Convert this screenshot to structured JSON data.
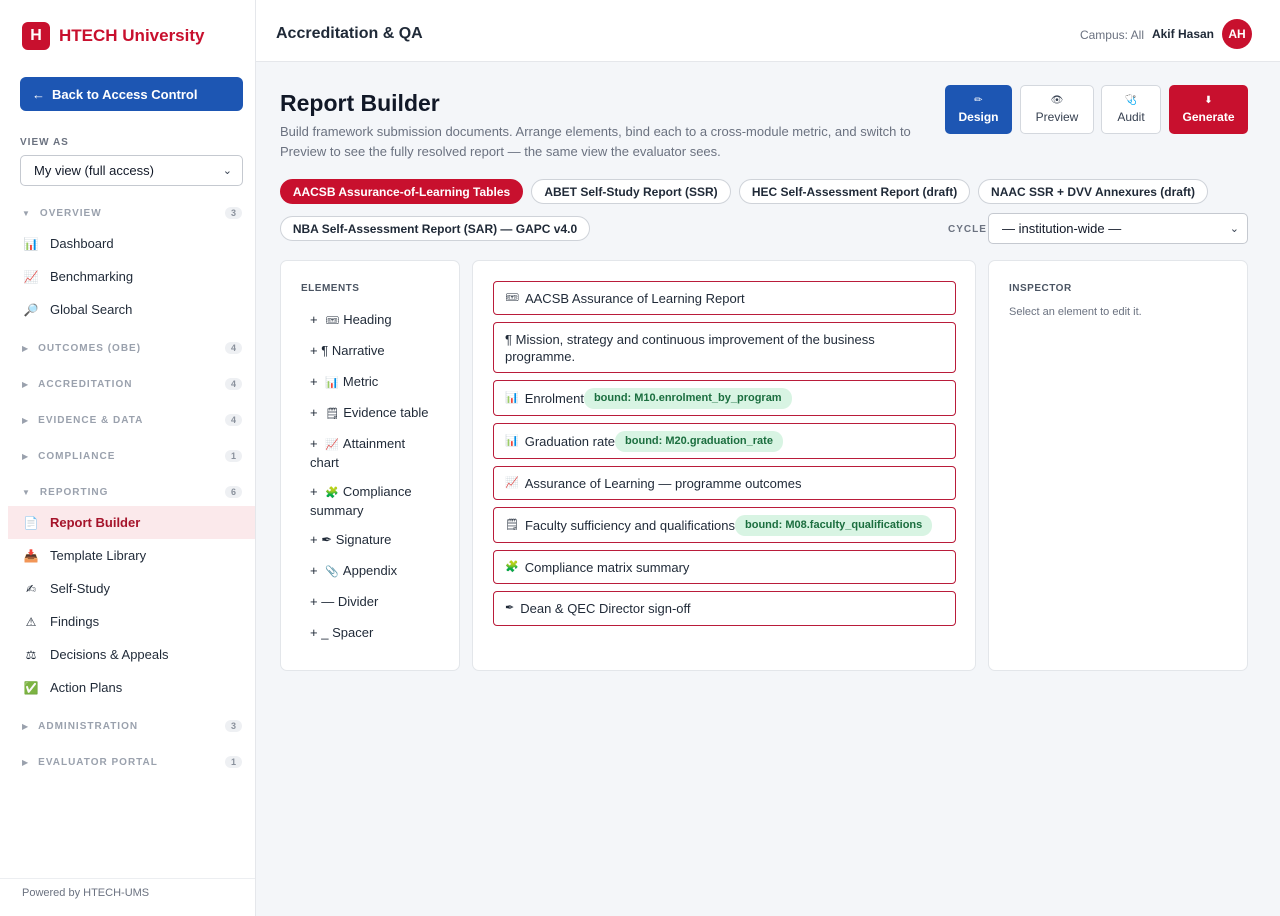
{
  "brand": {
    "logo": "H",
    "name": "HTECH University"
  },
  "sidebar": {
    "back_label": "Back to Access Control",
    "view_as_label": "VIEW AS",
    "view_as_value": "My view (full access)",
    "sections": [
      {
        "label": "OVERVIEW",
        "count": "3",
        "expanded": true
      },
      {
        "label": "OUTCOMES (OBE)",
        "count": "4",
        "expanded": false
      },
      {
        "label": "ACCREDITATION",
        "count": "4",
        "expanded": false
      },
      {
        "label": "EVIDENCE & DATA",
        "count": "4",
        "expanded": false
      },
      {
        "label": "COMPLIANCE",
        "count": "1",
        "expanded": false
      },
      {
        "label": "REPORTING",
        "count": "6",
        "expanded": true
      },
      {
        "label": "ADMINISTRATION",
        "count": "3",
        "expanded": false
      },
      {
        "label": "EVALUATOR PORTAL",
        "count": "1",
        "expanded": false
      }
    ],
    "overview_items": [
      {
        "label": "Dashboard",
        "icon": "📊"
      },
      {
        "label": "Benchmarking",
        "icon": "📈"
      },
      {
        "label": "Global Search",
        "icon": "🔎"
      }
    ],
    "reporting_items": [
      {
        "label": "Report Builder",
        "icon": "📄"
      },
      {
        "label": "Template Library",
        "icon": "📥"
      },
      {
        "label": "Self-Study",
        "icon": "✍"
      },
      {
        "label": "Findings",
        "icon": "⚠"
      },
      {
        "label": "Decisions & Appeals",
        "icon": "⚖"
      },
      {
        "label": "Action Plans",
        "icon": "✅"
      }
    ],
    "powered_by": "Powered by HTECH-UMS"
  },
  "header": {
    "title": "Accreditation & QA",
    "campus": "Campus: All",
    "user_name": "Akif Hasan",
    "avatar_initials": "AH"
  },
  "main": {
    "title": "Report Builder",
    "description": "Build framework submission documents. Arrange elements, bind each to a cross-module metric, and switch to Preview to see the fully resolved report — the same view the evaluator sees.",
    "modes": [
      {
        "label": "Design",
        "icon": "✏",
        "active": true
      },
      {
        "label": "Preview",
        "icon": "👁"
      },
      {
        "label": "Audit",
        "icon": "🩺"
      },
      {
        "label": "Generate",
        "icon": "⬇"
      }
    ],
    "frameworks": [
      "AACSB Assurance-of-Learning Tables",
      "ABET Self-Study Report (SSR)",
      "HEC Self-Assessment Report (draft)",
      "NAAC SSR + DVV Annexures (draft)",
      "NBA Self-Assessment Report (SAR) — GAPC v4.0"
    ],
    "active_framework_index": 0,
    "cycle_label": "CYCLE",
    "cycle_value": "— institution-wide —",
    "elements_label": "ELEMENTS",
    "elements": [
      {
        "label": "Heading",
        "icon": "🎟"
      },
      {
        "label": "Narrative",
        "icon": "¶"
      },
      {
        "label": "Metric",
        "icon": "📊"
      },
      {
        "label": "Evidence table",
        "icon": "🗒"
      },
      {
        "label": "Attainment chart",
        "icon": "📈"
      },
      {
        "label": "Compliance summary",
        "icon": "🧩"
      },
      {
        "label": "Signature",
        "icon": "✒"
      },
      {
        "label": "Appendix",
        "icon": "📎"
      },
      {
        "label": "Divider",
        "icon": "—"
      },
      {
        "label": "Spacer",
        "icon": "_"
      }
    ],
    "canvas": [
      {
        "label": "AACSB Assurance of Learning Report",
        "icon": "🎟",
        "binding": ""
      },
      {
        "label": "Mission, strategy and continuous improvement of the business programme.",
        "icon": "¶",
        "binding": ""
      },
      {
        "label": "Enrolment",
        "icon": "📊",
        "binding": "bound: M10.enrolment_by_program"
      },
      {
        "label": "Graduation rate",
        "icon": "📊",
        "binding": "bound: M20.graduation_rate"
      },
      {
        "label": "Assurance of Learning — programme outcomes",
        "icon": "📈",
        "binding": ""
      },
      {
        "label": "Faculty sufficiency and qualifications",
        "icon": "🗒",
        "binding": "bound: M08.faculty_qualifications"
      },
      {
        "label": "Compliance matrix summary",
        "icon": "🧩",
        "binding": ""
      },
      {
        "label": "Dean & QEC Director sign-off",
        "icon": "✒",
        "binding": ""
      }
    ],
    "inspector_label": "INSPECTOR",
    "inspector_hint": "Select an element to edit it."
  },
  "colors": {
    "brand_red": "#c8102e",
    "accent_blue": "#1d56b3",
    "badge_green": "#d8f4e3"
  }
}
